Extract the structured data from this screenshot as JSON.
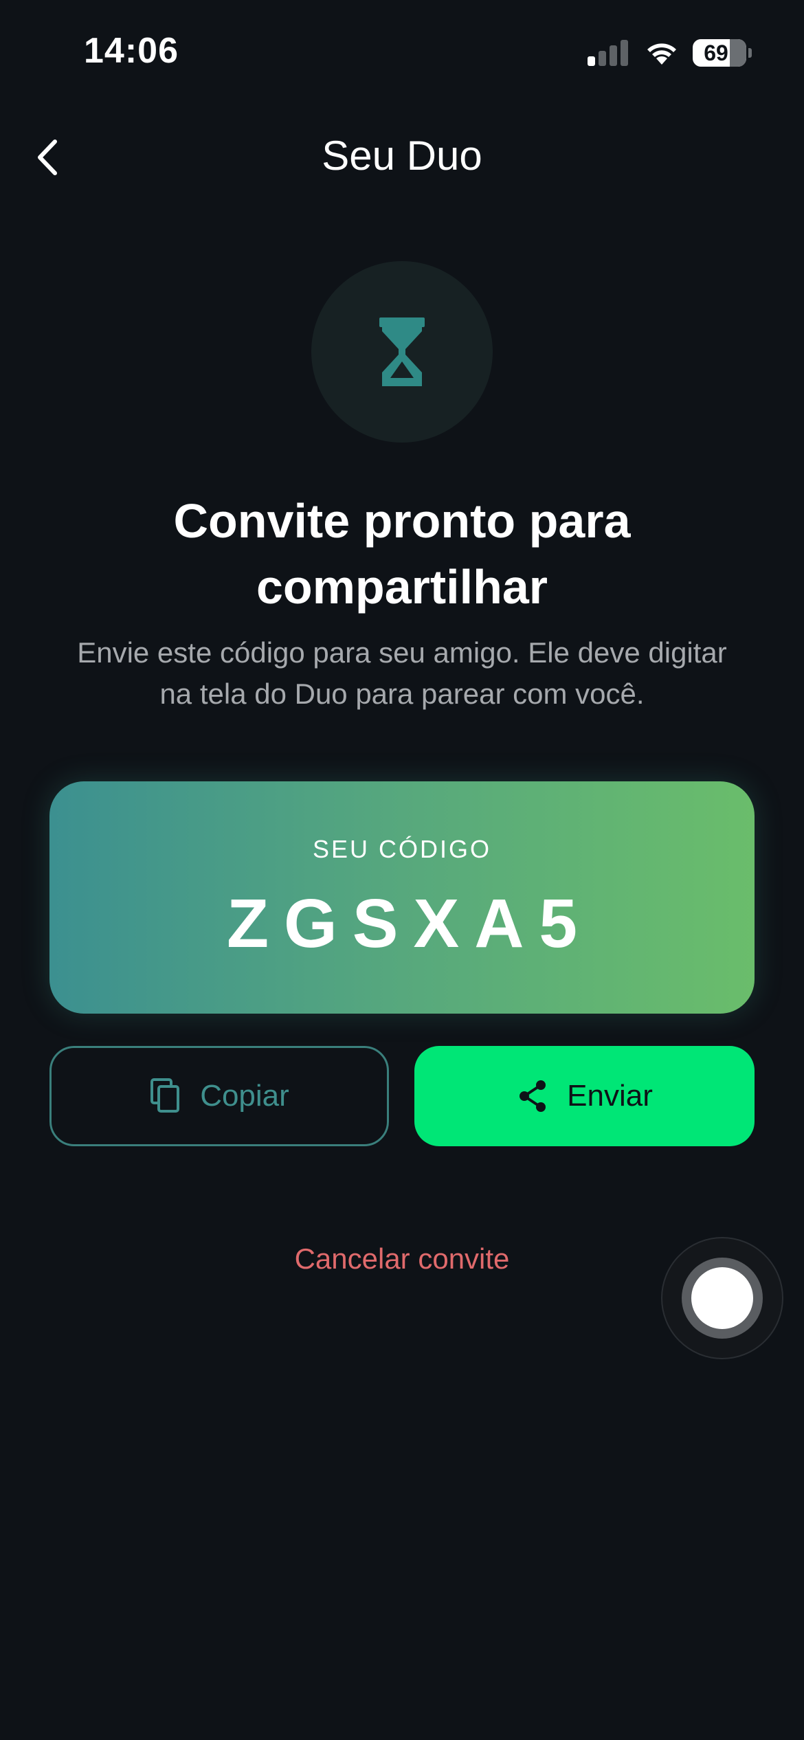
{
  "status_bar": {
    "time": "14:06",
    "battery": "69"
  },
  "nav": {
    "title": "Seu Duo"
  },
  "hero": {
    "icon": "hourglass-icon",
    "headline": "Convite pronto para compartilhar",
    "subtext": "Envie este código para seu amigo. Ele deve digitar na tela do Duo para parear com você."
  },
  "code_card": {
    "label": "SEU CÓDIGO",
    "code": "ZGSXA5"
  },
  "actions": {
    "copy_label": "Copiar",
    "copy_icon": "copy-icon",
    "send_label": "Enviar",
    "send_icon": "share-icon"
  },
  "cancel": {
    "label": "Cancelar convite"
  },
  "colors": {
    "background": "#0e1217",
    "accent_green": "#00e676",
    "teal": "#3f8f8d",
    "danger": "#e06a6c",
    "gradient_start": "#3c9090",
    "gradient_end": "#6abd6b"
  }
}
